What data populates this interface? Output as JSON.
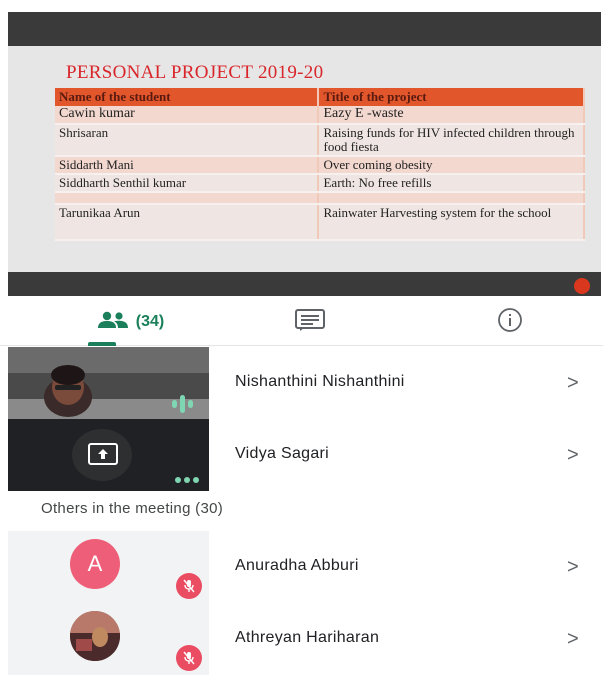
{
  "slide": {
    "title": "PERSONAL PROJECT 2019-20",
    "table": {
      "headers": [
        "Name of the student",
        "Title of the project"
      ],
      "rows": [
        [
          "Cawin kumar",
          "Eazy E -waste"
        ],
        [
          "Shrisaran",
          "Raising funds for HIV infected children through food fiesta"
        ],
        [
          "Siddarth Mani",
          "Over coming obesity"
        ],
        [
          "Siddharth  Senthil kumar",
          "Earth: No free refills"
        ],
        [
          "",
          ""
        ],
        [
          "Tarunikaa  Arun",
          "Rainwater Harvesting system for the school"
        ]
      ]
    }
  },
  "tabs": {
    "people_count": "(34)",
    "people_icon": "people-icon",
    "chat_icon": "chat-icon",
    "info_icon": "info-icon",
    "accent_color": "#1a7f5a"
  },
  "participants": [
    {
      "name": "Nishanthini Nishanthini",
      "status": "speaking"
    },
    {
      "name": "Vidya Sagari",
      "status": "presenting"
    }
  ],
  "others": {
    "label": "Others in the meeting (30)",
    "items": [
      {
        "name": "Anuradha Abburi",
        "avatar_letter": "A",
        "muted": true
      },
      {
        "name": "Athreyan Hariharan",
        "muted": true
      }
    ]
  },
  "chevron": ">"
}
